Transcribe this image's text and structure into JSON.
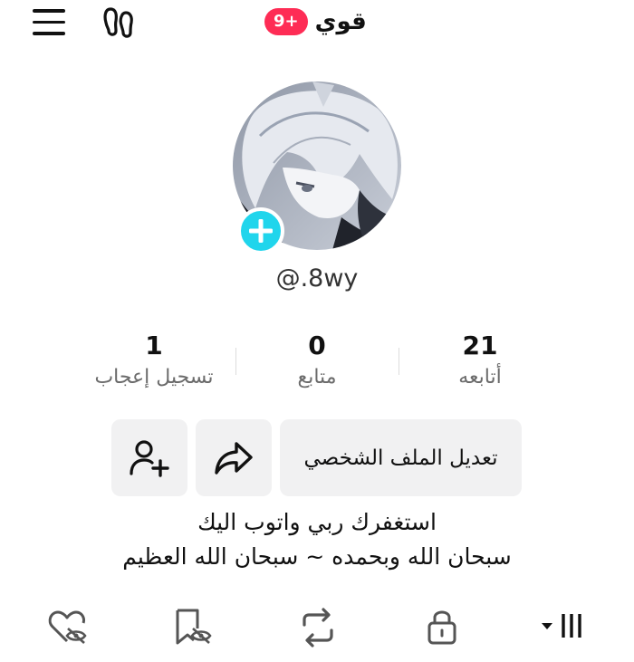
{
  "header": {
    "title": "قوي",
    "notification_badge": "9+",
    "menu_icon": "hamburger-menu-icon",
    "footprint_icon": "footprints-icon"
  },
  "profile": {
    "username": "@.8wy",
    "add_icon": "plus-icon",
    "accent_color": "#20d5ec",
    "badge_color": "#fe2c55"
  },
  "stats": {
    "following": {
      "count": "21",
      "label": "أتابعه"
    },
    "followers": {
      "count": "0",
      "label": "متابع"
    },
    "likes": {
      "count": "1",
      "label": "تسجيل إعجاب"
    }
  },
  "actions": {
    "edit_label": "تعديل الملف الشخصي",
    "share_icon": "share-arrow-icon",
    "add_friend_icon": "add-user-icon"
  },
  "bio": {
    "line1": "استغفرك ربي واتوب اليك",
    "line2": "سبحان الله وبحمده ~ سبحان الله العظيم"
  },
  "tabs": {
    "icons": [
      "videos-grid-icon",
      "private-lock-icon",
      "reposts-icon",
      "favorites-hidden-icon",
      "liked-hidden-icon"
    ]
  }
}
